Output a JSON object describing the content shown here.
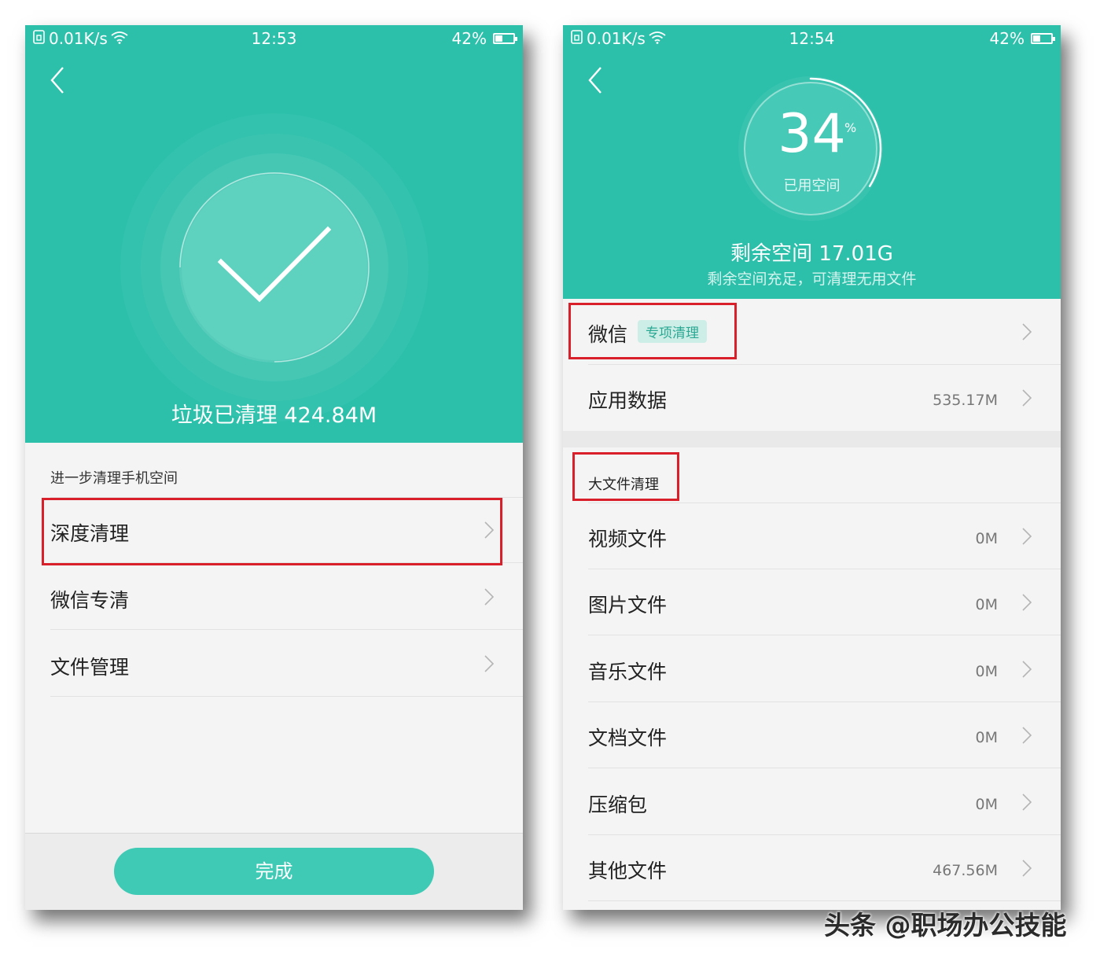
{
  "left": {
    "status": {
      "speed": "0.01K/s",
      "time": "12:53",
      "battery": "42%",
      "battery_level": 0.42
    },
    "cleaned_text": "垃圾已清理 424.84M",
    "section_label": "进一步清理手机空间",
    "items": [
      {
        "label": "深度清理"
      },
      {
        "label": "微信专清"
      },
      {
        "label": "文件管理"
      }
    ],
    "done_label": "完成"
  },
  "right": {
    "status": {
      "speed": "0.01K/s",
      "time": "12:54",
      "battery": "42%",
      "battery_level": 0.42
    },
    "used_percent": "34",
    "used_fraction": 0.34,
    "percent_sign": "%",
    "used_label": "已用空间",
    "remaining_title": "剩余空间 17.01G",
    "remaining_sub": "剩余空间充足，可清理无用文件",
    "wechat": {
      "label": "微信",
      "tag": "专项清理"
    },
    "app_data": {
      "label": "应用数据",
      "value": "535.17M"
    },
    "big_files_label": "大文件清理",
    "files": [
      {
        "label": "视频文件",
        "value": "0M"
      },
      {
        "label": "图片文件",
        "value": "0M"
      },
      {
        "label": "音乐文件",
        "value": "0M"
      },
      {
        "label": "文档文件",
        "value": "0M"
      },
      {
        "label": "压缩包",
        "value": "0M"
      },
      {
        "label": "其他文件",
        "value": "467.56M"
      }
    ]
  },
  "watermark": "头条 @职场办公技能",
  "colors": {
    "teal": "#2cc0ab",
    "button": "#3ecab4",
    "highlight": "#d9202a",
    "tag_bg": "#cdeee6",
    "tag_text": "#2aa893"
  }
}
